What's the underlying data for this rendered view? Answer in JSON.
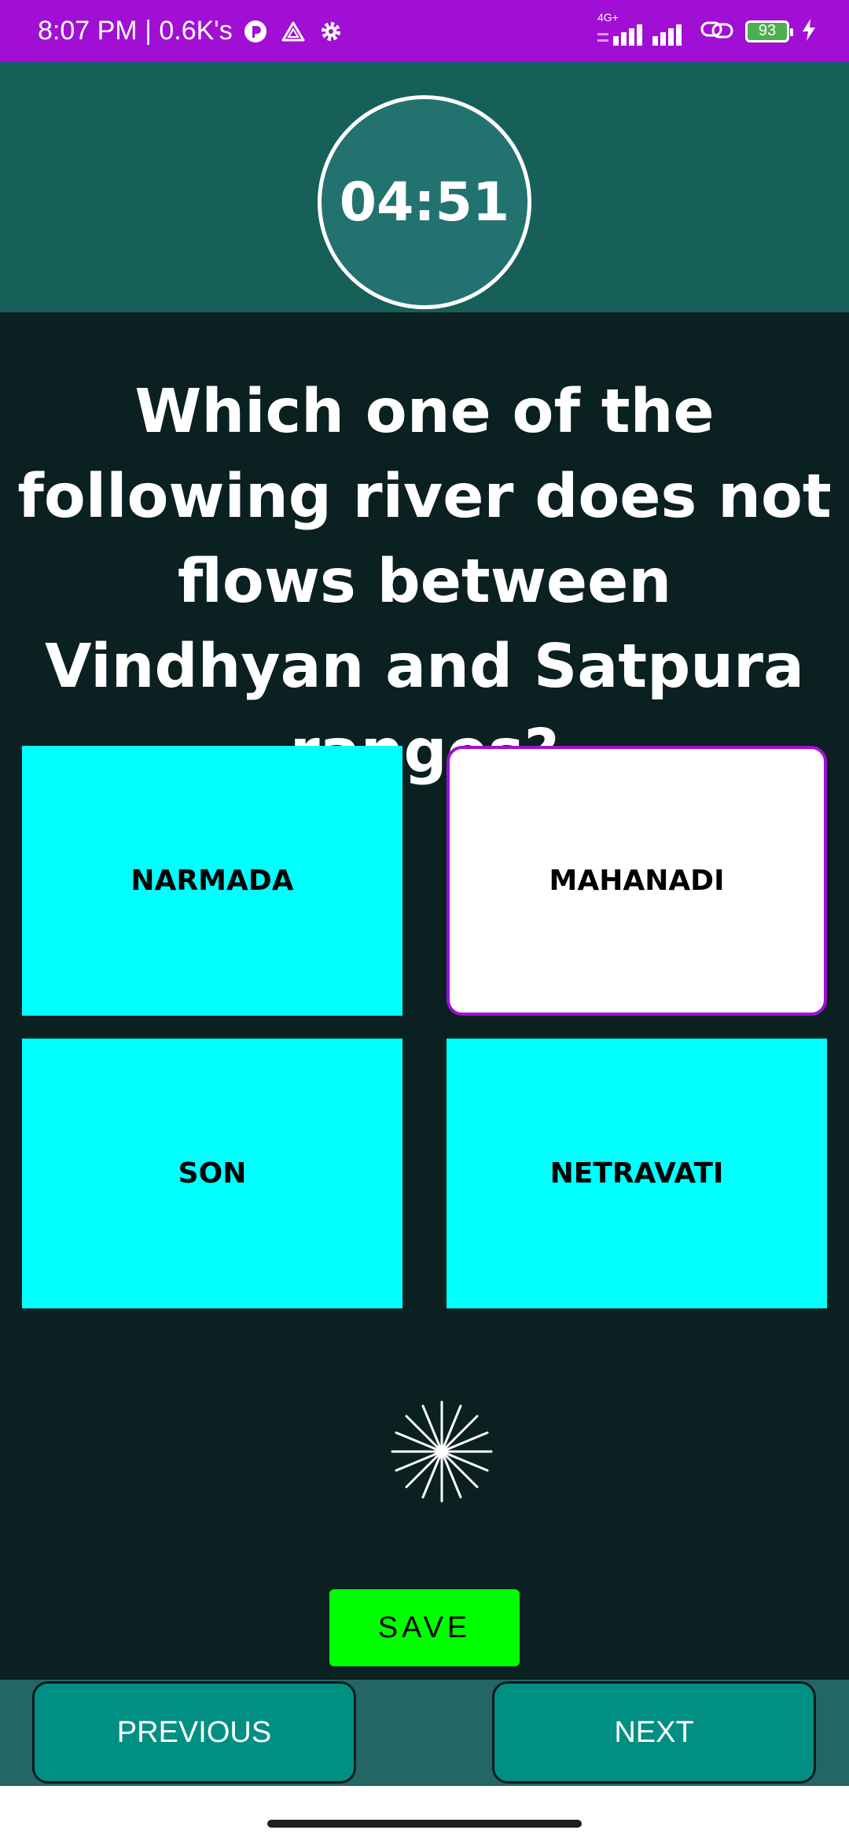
{
  "status_bar": {
    "time_text": "8:07 PM | 0.6K's",
    "network_label": "4G+",
    "battery_level": "93",
    "accent_color": "#a10fd5"
  },
  "timer": {
    "value": "04:51"
  },
  "question": {
    "text": "Which one of the following river does not flows between Vindhyan and Satpura ranges?"
  },
  "options": [
    {
      "label": "NARMADA",
      "selected": false
    },
    {
      "label": "MAHANADI",
      "selected": true
    },
    {
      "label": "SON",
      "selected": false
    },
    {
      "label": "NETRAVATI",
      "selected": false
    }
  ],
  "actions": {
    "save_label": "SAVE",
    "previous_label": "PREVIOUS",
    "next_label": "NEXT"
  },
  "colors": {
    "option_bg": "#00ffff",
    "selected_border": "#a10fd5",
    "save_bg": "#00ff00",
    "nav_button_bg": "#008f82",
    "background": "#0b2020",
    "header_bg": "#17605a"
  },
  "icons": [
    "r-circle-icon",
    "drive-icon",
    "gear-icon",
    "signal-icon",
    "link-icon",
    "battery-icon",
    "charging-icon",
    "spinner-icon"
  ]
}
